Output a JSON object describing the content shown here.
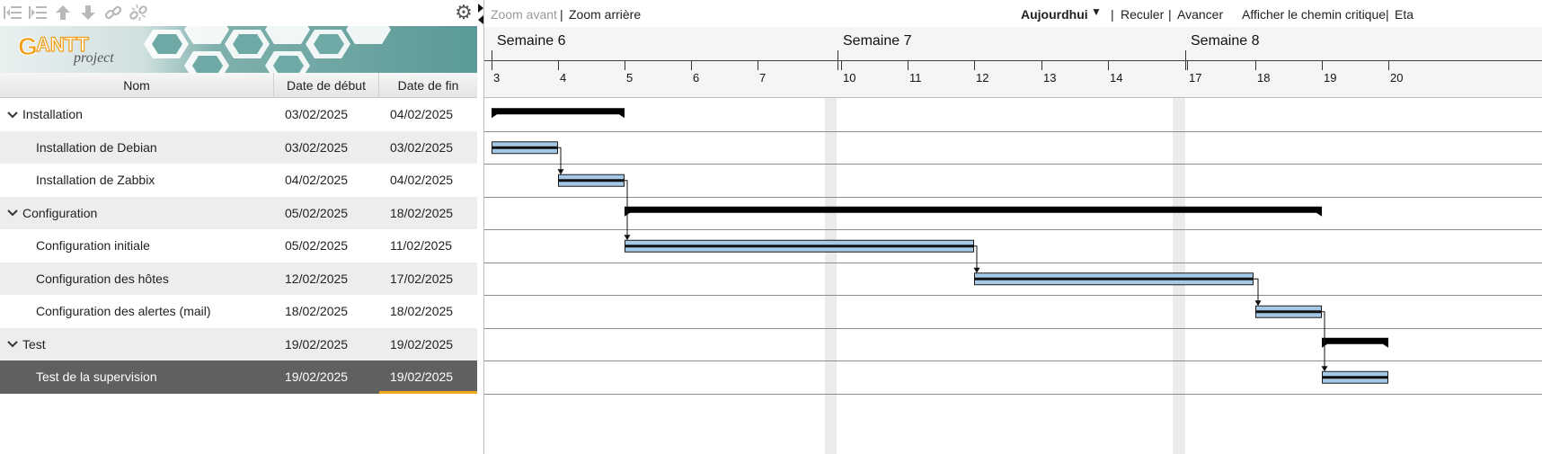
{
  "toolbar": {
    "icons": [
      "unindent-icon",
      "indent-icon",
      "move-up-icon",
      "move-down-icon",
      "link-icon",
      "unlink-icon",
      "gear-icon"
    ]
  },
  "logo": {
    "brand": "GANTT",
    "sub": "project"
  },
  "table": {
    "headers": {
      "name": "Nom",
      "start": "Date de début",
      "end": "Date de fin"
    },
    "rows": [
      {
        "name": "Installation",
        "start": "03/02/2025",
        "end": "04/02/2025",
        "group": true
      },
      {
        "name": "Installation de Debian",
        "start": "03/02/2025",
        "end": "03/02/2025",
        "group": false
      },
      {
        "name": "Installation de Zabbix",
        "start": "04/02/2025",
        "end": "04/02/2025",
        "group": false
      },
      {
        "name": "Configuration",
        "start": "05/02/2025",
        "end": "18/02/2025",
        "group": true
      },
      {
        "name": "Configuration initiale",
        "start": "05/02/2025",
        "end": "11/02/2025",
        "group": false
      },
      {
        "name": "Configuration des hôtes",
        "start": "12/02/2025",
        "end": "17/02/2025",
        "group": false
      },
      {
        "name": "Configuration des alertes (mail)",
        "start": "18/02/2025",
        "end": "18/02/2025",
        "group": false
      },
      {
        "name": "Test",
        "start": "19/02/2025",
        "end": "19/02/2025",
        "group": true
      },
      {
        "name": "Test de la supervision",
        "start": "19/02/2025",
        "end": "19/02/2025",
        "group": false,
        "selected": true
      }
    ]
  },
  "right_toolbar": {
    "zoom_in": "Zoom avant",
    "zoom_out": "Zoom arrière",
    "today": "Aujourdhui",
    "back": "Reculer",
    "forward": "Avancer",
    "critical_path": "Afficher le chemin critique",
    "truncated": "Eta"
  },
  "timeline": {
    "weeks": [
      "Semaine 6",
      "Semaine 7",
      "Semaine 8"
    ],
    "days": [
      "3",
      "4",
      "5",
      "6",
      "7",
      "10",
      "11",
      "12",
      "13",
      "14",
      "17",
      "18",
      "19",
      "20"
    ]
  },
  "gantt": {
    "summaries": [
      {
        "row": 0,
        "from": "03/02/2025",
        "to": "04/02/2025"
      },
      {
        "row": 3,
        "from": "05/02/2025",
        "to": "18/02/2025"
      },
      {
        "row": 7,
        "from": "19/02/2025",
        "to": "19/02/2025"
      }
    ],
    "tasks": [
      {
        "row": 1,
        "from": "03/02/2025",
        "to": "03/02/2025"
      },
      {
        "row": 2,
        "from": "04/02/2025",
        "to": "04/02/2025"
      },
      {
        "row": 4,
        "from": "05/02/2025",
        "to": "11/02/2025"
      },
      {
        "row": 5,
        "from": "12/02/2025",
        "to": "17/02/2025"
      },
      {
        "row": 6,
        "from": "18/02/2025",
        "to": "18/02/2025"
      },
      {
        "row": 8,
        "from": "19/02/2025",
        "to": "19/02/2025"
      }
    ],
    "dependencies": [
      [
        1,
        2
      ],
      [
        2,
        4
      ],
      [
        4,
        5
      ],
      [
        5,
        6
      ],
      [
        6,
        8
      ]
    ],
    "colors": {
      "task_fill": "#a4c8e6",
      "task_border": "#1b1b1b",
      "summary": "#000000",
      "weekend": "#ebebeb",
      "row_line": "#8c8c8c",
      "selection": "#606060",
      "accent": "#f3a81b"
    }
  }
}
